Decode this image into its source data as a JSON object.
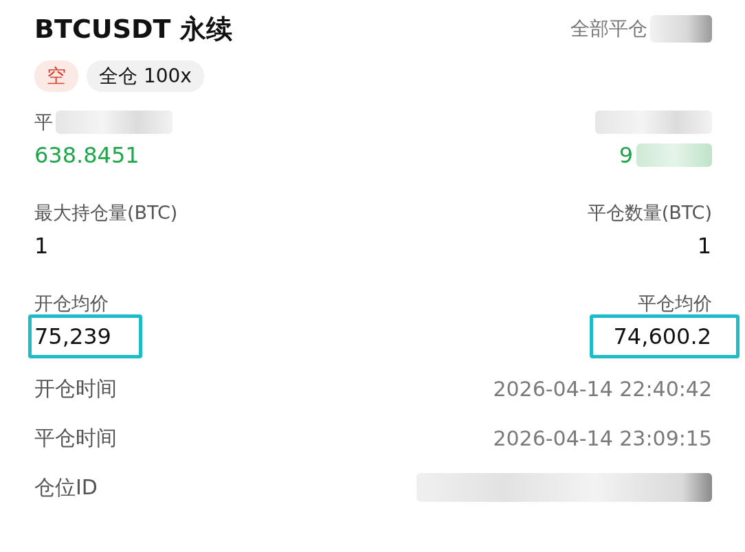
{
  "header": {
    "title": "BTCUSDT 永续",
    "close_all": "全部平仓",
    "close_all_redacted": true
  },
  "tags": [
    {
      "label": "空",
      "kind": "side"
    },
    {
      "label": "全仓 100x",
      "kind": "mode"
    }
  ],
  "stats": [
    {
      "left": {
        "label": "平",
        "label_redacted": true,
        "value": "638.8451",
        "positive": true,
        "highlighted": false
      },
      "right": {
        "label_redacted": true,
        "value": "9",
        "positive": true,
        "value_redacted": true,
        "highlighted": false
      }
    },
    {
      "left": {
        "label": "最大持仓量(BTC)",
        "value": "1",
        "positive": false,
        "highlighted": false
      },
      "right": {
        "label": "平仓数量(BTC)",
        "value": "1",
        "positive": false,
        "highlighted": false
      }
    },
    {
      "left": {
        "label": "开仓均价",
        "value": "75,239",
        "positive": false,
        "highlighted": true
      },
      "right": {
        "label": "平仓均价",
        "value": "74,600.2",
        "positive": false,
        "highlighted": true
      }
    }
  ],
  "details": [
    {
      "label": "开仓时间",
      "value": "2026-04-14 22:40:42"
    },
    {
      "label": "平仓时间",
      "value": "2026-04-14 23:09:15"
    },
    {
      "label": "仓位ID",
      "redacted": true
    }
  ]
}
